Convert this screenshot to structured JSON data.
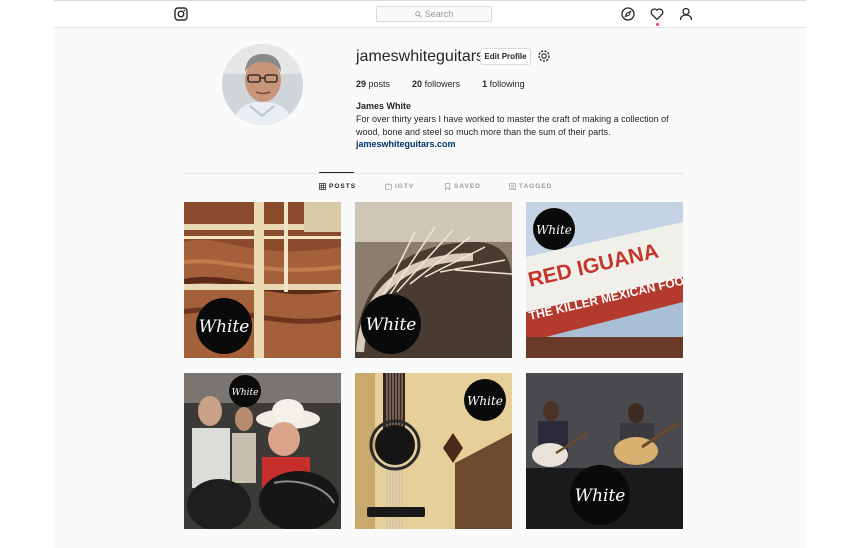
{
  "topbar": {
    "search_placeholder": "Search",
    "icons": [
      "instagram-logo-icon",
      "explore-compass-icon",
      "activity-heart-icon",
      "profile-person-icon"
    ],
    "notification_dot_color": "#ed4956"
  },
  "profile": {
    "username": "jameswhiteguitars",
    "edit_profile_label": "Edit Profile",
    "posts_count": "29",
    "posts_label": "posts",
    "followers_count": "20",
    "followers_label": "followers",
    "following_count": "1",
    "following_label": "following",
    "full_name": "James White",
    "bio": "For over thirty years I have worked to master the craft of making a collection of wood, bone and steel so much more than the sum of their parts.",
    "website": "jameswhiteguitars.com"
  },
  "tabs": [
    {
      "label": "POSTS",
      "active": true
    },
    {
      "label": "IGTV",
      "active": false
    },
    {
      "label": "SAVED",
      "active": false
    },
    {
      "label": "TAGGED",
      "active": false
    }
  ],
  "posts": [
    {
      "watermark": "White",
      "sign_line_1": "",
      "sign_line_2": ""
    },
    {
      "watermark": "White",
      "sign_line_1": "",
      "sign_line_2": ""
    },
    {
      "watermark": "White",
      "sign_line_1": "RED IGUANA",
      "sign_line_2": "THE KILLER MEXICAN FOOD"
    },
    {
      "watermark": "White",
      "sign_line_1": "",
      "sign_line_2": ""
    },
    {
      "watermark": "White",
      "sign_line_1": "",
      "sign_line_2": ""
    },
    {
      "watermark": "White",
      "sign_line_1": "",
      "sign_line_2": ""
    }
  ],
  "colors": {
    "link": "#003569",
    "muted": "#999999",
    "text": "#262626",
    "border": "#dbdbdb"
  }
}
